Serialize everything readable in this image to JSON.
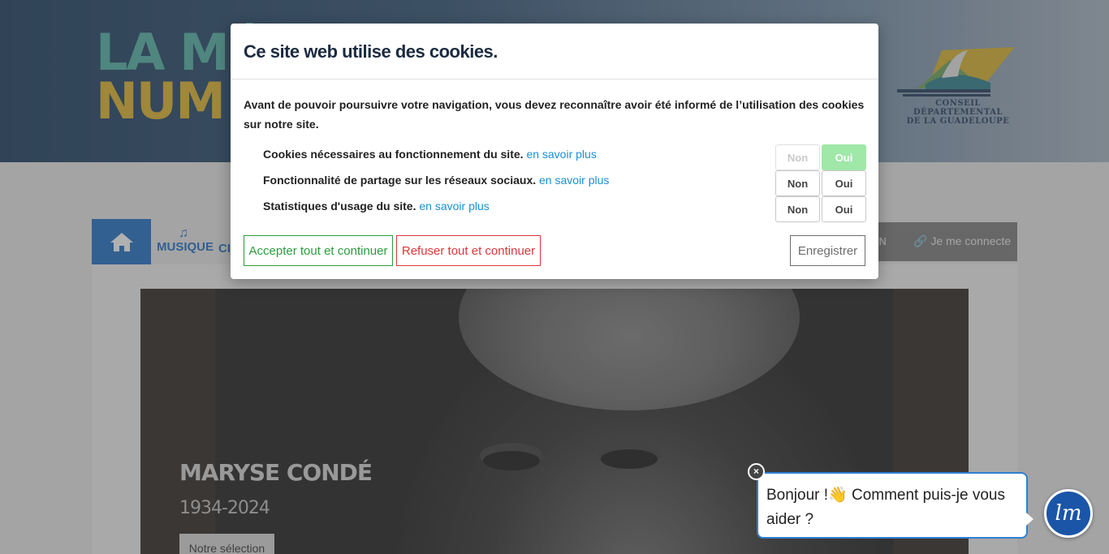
{
  "header": {
    "logo_line1": "LA MÉ",
    "logo_line2": "NUM",
    "partner_logo_text_line1": "CONSEIL DÉPARTEMENTAL",
    "partner_logo_text_line2": "DE LA GUADELOUPE"
  },
  "nav": {
    "home_icon": "home-icon",
    "musique_icon": "music-note-icon",
    "musique_label": "MUSIQUE",
    "cinema_label_partial": "CI",
    "oun_label_partial": "OUN",
    "login_icon": "link-icon",
    "login_label": "Je me connecte"
  },
  "hero": {
    "title": "MARYSE CONDÉ",
    "years": "1934-2024",
    "button_label": "Notre sélection"
  },
  "cookie_modal": {
    "title": "Ce site web utilise des cookies.",
    "intro": "Avant de pouvoir poursuivre votre navigation, vous devez reconnaître avoir été informé de l’utilisation des cookies sur notre site.",
    "rows": [
      {
        "label": "Cookies nécessaires au fonctionnement du site.",
        "link": "en savoir plus",
        "non": "Non",
        "oui": "Oui",
        "state": "oui-locked"
      },
      {
        "label": "Fonctionnalité de partage sur les réseaux sociaux.",
        "link": "en savoir plus",
        "non": "Non",
        "oui": "Oui",
        "state": "unset"
      },
      {
        "label": "Statistiques d'usage du site.",
        "link": "en savoir plus",
        "non": "Non",
        "oui": "Oui",
        "state": "unset"
      }
    ],
    "accept_label": "Accepter tout et continuer",
    "refuse_label": "Refuser tout et continuer",
    "save_label": "Enregistrer"
  },
  "chat": {
    "greeting": "Bonjour !👋 Comment puis-je vous aider ?",
    "close_label": "×",
    "avatar_text": "lm"
  },
  "colors": {
    "accent_blue": "#1a6dc7",
    "accept_green": "#2c9b3f",
    "refuse_red": "#d9383a",
    "active_toggle": "#9fe8a8",
    "link_blue": "#1a8fd0"
  }
}
